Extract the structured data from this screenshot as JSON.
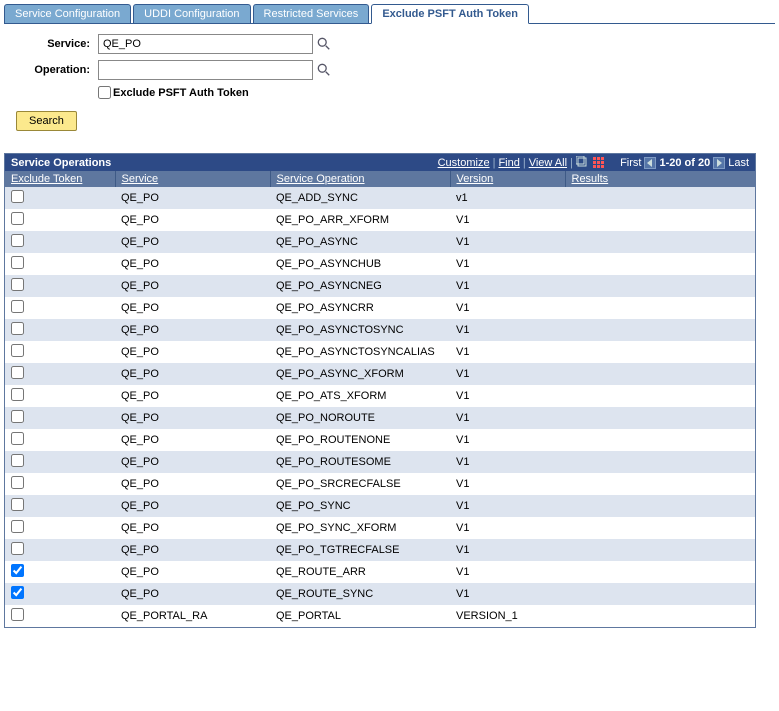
{
  "tabs": [
    {
      "label": "Service Configuration",
      "active": false
    },
    {
      "label": "UDDI Configuration",
      "active": false
    },
    {
      "label": "Restricted Services",
      "active": false
    },
    {
      "label": "Exclude PSFT Auth Token",
      "active": true
    }
  ],
  "form": {
    "service_label": "Service:",
    "service_value": "QE_PO",
    "operation_label": "Operation:",
    "operation_value": "",
    "exclude_label": "Exclude PSFT Auth Token",
    "exclude_checked": false,
    "search_label": "Search"
  },
  "grid": {
    "title": "Service Operations",
    "customize": "Customize",
    "find": "Find",
    "view_all": "View All",
    "first": "First",
    "range": "1-20 of 20",
    "last": "Last",
    "columns": {
      "exclude": "Exclude Token",
      "service": "Service",
      "operation": "Service Operation",
      "version": "Version",
      "results": "Results"
    },
    "rows": [
      {
        "checked": false,
        "service": "QE_PO",
        "operation": "QE_ADD_SYNC",
        "version": "v1"
      },
      {
        "checked": false,
        "service": "QE_PO",
        "operation": "QE_PO_ARR_XFORM",
        "version": "V1"
      },
      {
        "checked": false,
        "service": "QE_PO",
        "operation": "QE_PO_ASYNC",
        "version": "V1"
      },
      {
        "checked": false,
        "service": "QE_PO",
        "operation": "QE_PO_ASYNCHUB",
        "version": "V1"
      },
      {
        "checked": false,
        "service": "QE_PO",
        "operation": "QE_PO_ASYNCNEG",
        "version": "V1"
      },
      {
        "checked": false,
        "service": "QE_PO",
        "operation": "QE_PO_ASYNCRR",
        "version": "V1"
      },
      {
        "checked": false,
        "service": "QE_PO",
        "operation": "QE_PO_ASYNCTOSYNC",
        "version": "V1"
      },
      {
        "checked": false,
        "service": "QE_PO",
        "operation": "QE_PO_ASYNCTOSYNCALIAS",
        "version": "V1"
      },
      {
        "checked": false,
        "service": "QE_PO",
        "operation": "QE_PO_ASYNC_XFORM",
        "version": "V1"
      },
      {
        "checked": false,
        "service": "QE_PO",
        "operation": "QE_PO_ATS_XFORM",
        "version": "V1"
      },
      {
        "checked": false,
        "service": "QE_PO",
        "operation": "QE_PO_NOROUTE",
        "version": "V1"
      },
      {
        "checked": false,
        "service": "QE_PO",
        "operation": "QE_PO_ROUTENONE",
        "version": "V1"
      },
      {
        "checked": false,
        "service": "QE_PO",
        "operation": "QE_PO_ROUTESOME",
        "version": "V1"
      },
      {
        "checked": false,
        "service": "QE_PO",
        "operation": "QE_PO_SRCRECFALSE",
        "version": "V1"
      },
      {
        "checked": false,
        "service": "QE_PO",
        "operation": "QE_PO_SYNC",
        "version": "V1"
      },
      {
        "checked": false,
        "service": "QE_PO",
        "operation": "QE_PO_SYNC_XFORM",
        "version": "V1"
      },
      {
        "checked": false,
        "service": "QE_PO",
        "operation": "QE_PO_TGTRECFALSE",
        "version": "V1"
      },
      {
        "checked": true,
        "service": "QE_PO",
        "operation": "QE_ROUTE_ARR",
        "version": "V1"
      },
      {
        "checked": true,
        "service": "QE_PO",
        "operation": "QE_ROUTE_SYNC",
        "version": "V1"
      },
      {
        "checked": false,
        "service": "QE_PORTAL_RA",
        "operation": "QE_PORTAL",
        "version": "VERSION_1"
      }
    ]
  }
}
